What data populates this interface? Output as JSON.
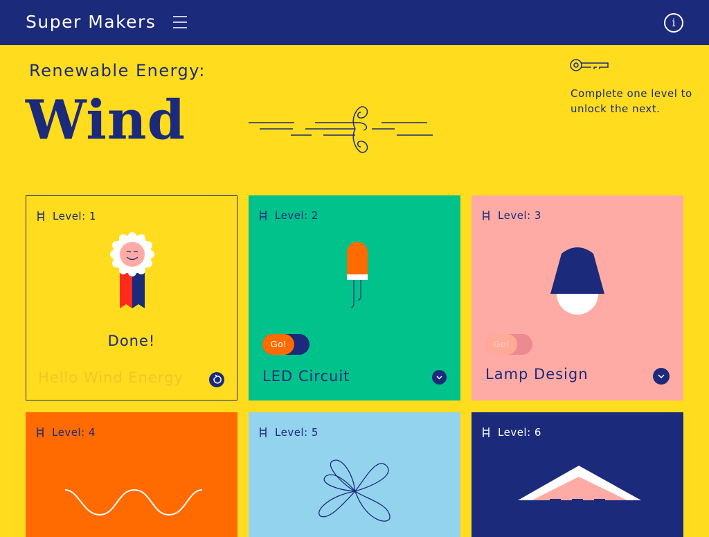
{
  "header": {
    "brand": "Super Makers",
    "menu_icon": "hamburger-menu-icon",
    "info_icon": "info-icon"
  },
  "hero": {
    "subtitle": "Renewable Energy:",
    "title": "Wind",
    "hint": "Complete one level to unlock the next.",
    "key_icon": "key-icon"
  },
  "colors": {
    "navy": "#1B2A7A",
    "yellow": "#FFDC1E",
    "green": "#00C28A",
    "pink": "#FFABA5",
    "orange": "#FF6B00",
    "light_blue": "#94D3EE"
  },
  "levels": [
    {
      "label": "Level: 1",
      "status": "Done!",
      "name": "Hello Wind Energy",
      "icon": "award-ribbon-icon"
    },
    {
      "label": "Level: 2",
      "go": "Go!",
      "name": "LED Circuit",
      "icon": "led-icon"
    },
    {
      "label": "Level: 3",
      "go": "Go!",
      "name": "Lamp Design",
      "icon": "lamp-icon"
    },
    {
      "label": "Level: 4",
      "icon": "wave-icon"
    },
    {
      "label": "Level: 5",
      "icon": "propeller-icon"
    },
    {
      "label": "Level: 6",
      "icon": "tent-icon"
    }
  ]
}
